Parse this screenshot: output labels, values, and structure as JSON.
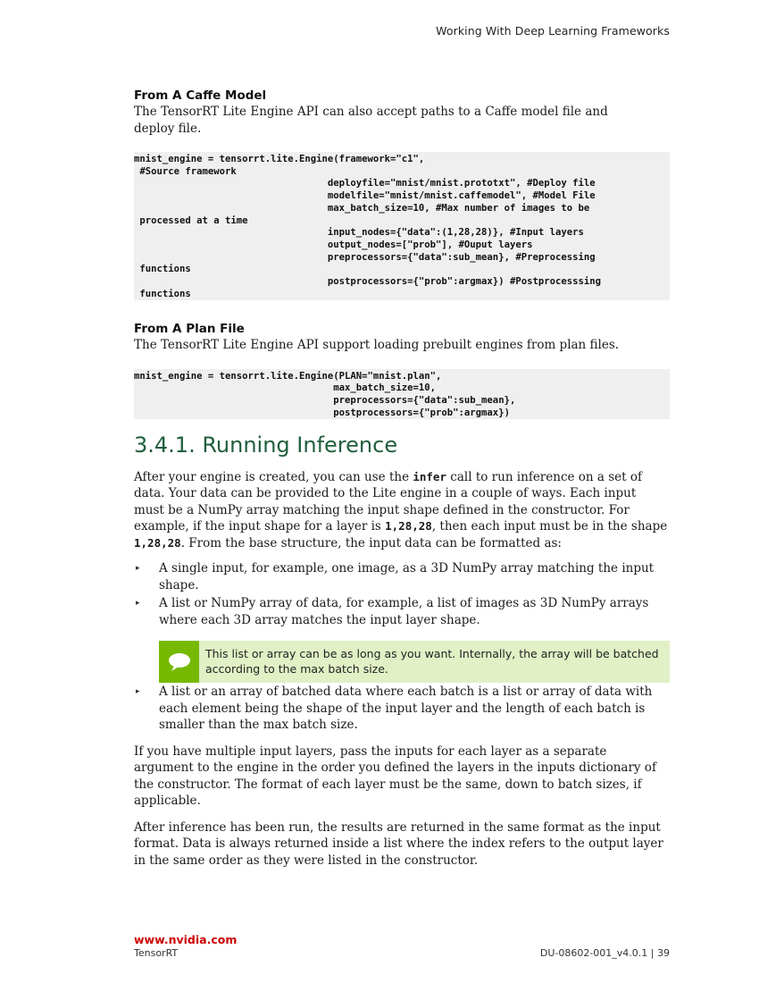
{
  "header": {
    "title": "Working With Deep Learning Frameworks"
  },
  "section_caffe": {
    "heading": "From A Caffe Model",
    "text": "The TensorRT Lite Engine API can also accept paths to a Caffe model file and deploy file.",
    "code": "mnist_engine = tensorrt.lite.Engine(framework=\"c1\",\n #Source framework\n                                  deployfile=\"mnist/mnist.prototxt\", #Deploy file\n                                  modelfile=\"mnist/mnist.caffemodel\", #Model File\n                                  max_batch_size=10, #Max number of images to be\n processed at a time\n                                  input_nodes={\"data\":(1,28,28)}, #Input layers\n                                  output_nodes=[\"prob\"], #Ouput layers\n                                  preprocessors={\"data\":sub_mean}, #Preprocessing\n functions\n                                  postprocessors={\"prob\":argmax}) #Postprocesssing\n functions"
  },
  "section_plan": {
    "heading": "From A Plan File",
    "text": "The TensorRT Lite Engine API support loading prebuilt engines from plan files.",
    "code": "mnist_engine = tensorrt.lite.Engine(PLAN=\"mnist.plan\",\n                                   max_batch_size=10,\n                                   preprocessors={\"data\":sub_mean},\n                                   postprocessors={\"prob\":argmax})"
  },
  "section_inference": {
    "heading": "3.4.1. Running Inference",
    "para1_a": "After your engine is created, you can use the ",
    "para1_code1": "infer",
    "para1_b": " call to run inference on a set of data. Your data can be provided to the Lite engine in a couple of ways. Each input must be a NumPy array matching the input shape defined in the constructor. For example, if the input shape for a layer is ",
    "para1_code2": "1,28,28",
    "para1_c": ", then each input must be in the shape ",
    "para1_code3": "1,28,28",
    "para1_d": ". From the base structure, the input data can be formatted as:",
    "bullet_marker": "▸",
    "bullet1": "A single input, for example, one image, as a 3D NumPy array matching the input shape.",
    "bullet2": "A list or NumPy array of data, for example, a list of images as 3D NumPy arrays where each 3D array matches the input layer shape.",
    "note": "This list or array can be as long as you want. Internally, the array will be batched according to the max batch size.",
    "bullet3": "A list or an array of batched data where each batch is a list or array of data with each element being the shape of the input layer and the length of each batch is smaller than the max batch size.",
    "para2": "If you have multiple input layers, pass the inputs for each layer as a separate argument to the engine in the order you defined the layers in the inputs dictionary of the constructor. The format of each layer must be the same, down to batch sizes, if applicable.",
    "para3": "After inference has been run, the results are returned in the same format as the input format. Data is always returned inside a list where the index refers to the output layer in the same order as they were listed in the constructor."
  },
  "footer": {
    "link": "www.nvidia.com",
    "product": "TensorRT",
    "doc_id": "DU-08602-001_v4.0.1 | 39"
  },
  "colors": {
    "heading_green": "#1f5e3c",
    "nvidia_green": "#76b900",
    "note_bg": "#e1f0c5",
    "link_red": "#cc0000",
    "code_bg": "#efefef"
  }
}
